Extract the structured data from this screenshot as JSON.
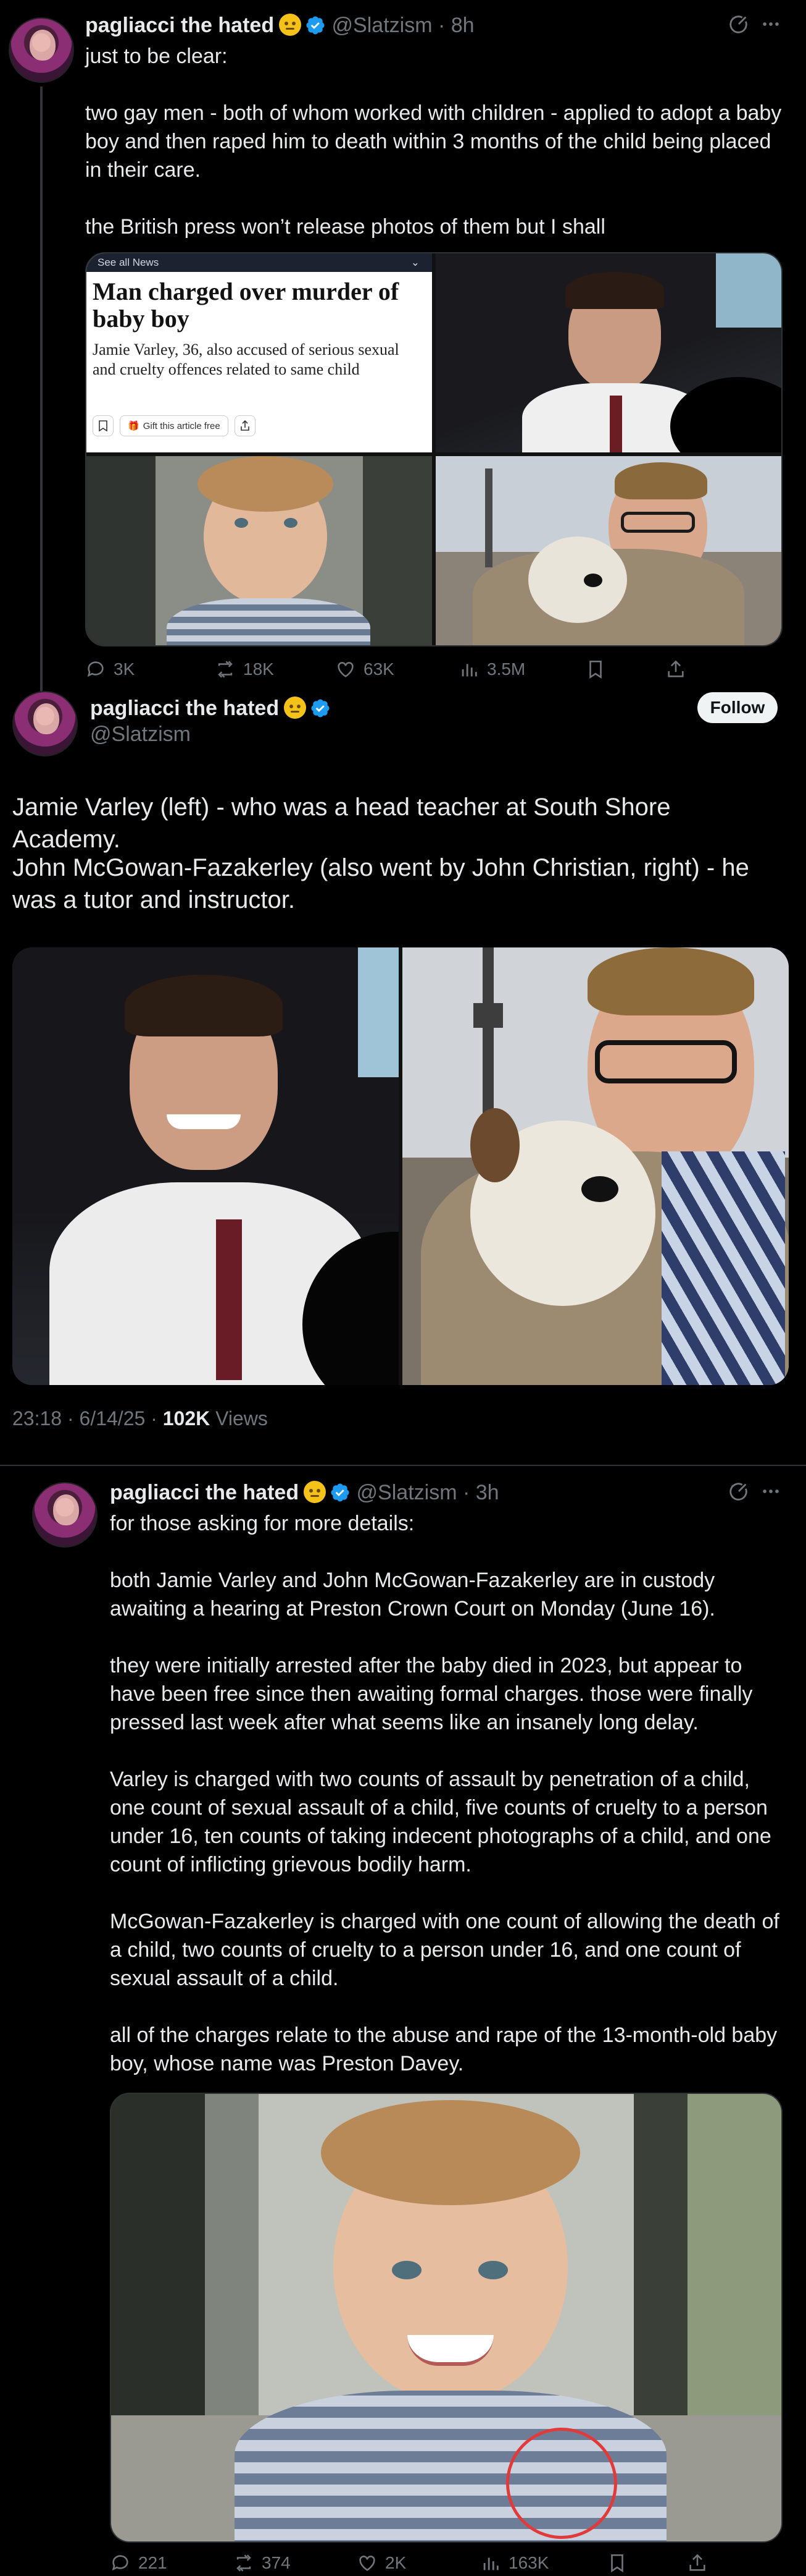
{
  "post1": {
    "name": "pagliacci the hated",
    "handle": "@Slatzism",
    "time": "8h",
    "text": "just to be clear:\n\ntwo gay men - both of whom worked with children - applied to adopt a baby boy and then raped him to death within 3 months of the child being placed in their care.\n\nthe British press won’t release photos of them but I shall",
    "news_card": {
      "top_label": "See all News",
      "headline": "Man charged over murder of baby boy",
      "subhead": "Jamie Varley, 36, also accused of serious sexual and cruelty offences related to same child",
      "gift_label": "Gift this article free"
    },
    "stats": {
      "replies": "3K",
      "reposts": "18K",
      "likes": "63K",
      "views": "3.5M"
    }
  },
  "post2": {
    "name": "pagliacci the hated",
    "handle": "@Slatzism",
    "follow_label": "Follow",
    "text1": "Jamie Varley (left) - who was a head teacher at South Shore Academy.",
    "text2": "John McGowan-Fazakerley (also went by John Christian, right) - he was a tutor and instructor.",
    "meta_time": "23:18 · 6/14/25 · ",
    "meta_views_count": "102K",
    "meta_views_label": " Views"
  },
  "post3": {
    "name": "pagliacci the hated",
    "handle": "@Slatzism",
    "time": "3h",
    "paragraphs": [
      "for those asking for more details:",
      "both Jamie Varley and John McGowan-Fazakerley are in custody awaiting a hearing at Preston Crown Court on Monday (June 16).",
      "they were initially arrested after the baby died in 2023, but appear to have been free since then awaiting formal charges. those were finally pressed last week after what seems like an insanely long delay.",
      "Varley is charged with two counts of assault by penetration of a child, one count of sexual assault of a child, five counts of cruelty to a person under 16, ten counts of taking indecent photographs of a child, and one count of inflicting grievous bodily harm.",
      "McGowan-Fazakerley is charged with one count of allowing the death of a child, two counts of cruelty to a person under 16, and one count of sexual assault of a child.",
      "all of the charges relate to the abuse and rape of the 13-month-old baby boy, whose name was Preston Davey."
    ],
    "stats": {
      "replies": "221",
      "reposts": "374",
      "likes": "2K",
      "views": "163K"
    }
  },
  "colors": {
    "background": "#000000",
    "text": "#e7e9ea",
    "muted": "#71767b",
    "verified": "#1d9bf0",
    "divider": "#2f3336"
  }
}
